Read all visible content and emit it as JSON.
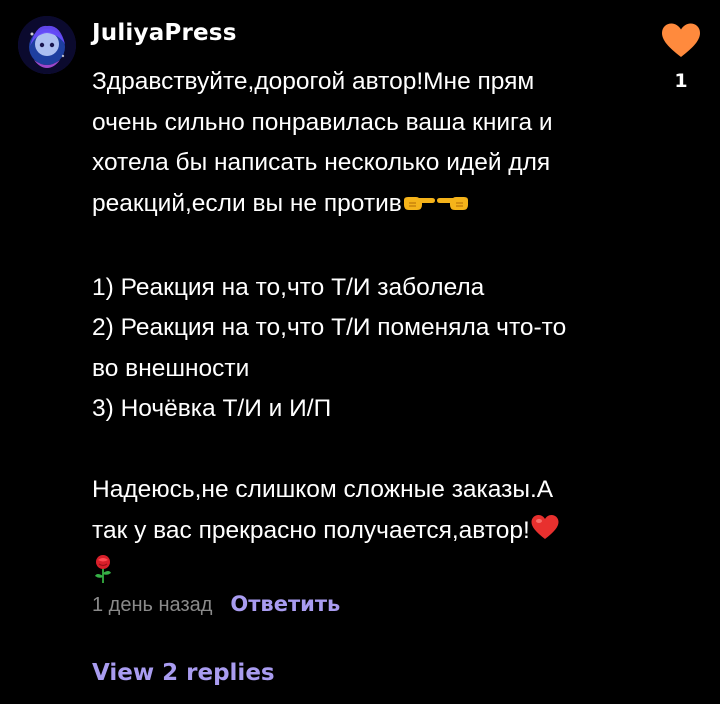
{
  "comment": {
    "username": "JuliyaPress",
    "like_count": "1",
    "paragraphs": {
      "intro": "Здравствуйте,дорогой автор!Мне прям\nочень сильно понравилась ваша книга и\nхотела бы написать несколько идей для\nреакций,если вы не против",
      "ideas": "1) Реакция на то,что Т/И заболела\n2) Реакция на то,что Т/И поменяла что-то\nво внешности\n3) Ночёвка Т/И и И/П",
      "outro": "Надеюсь,не слишком сложные заказы.А\nтак у вас прекрасно получается,автор!"
    },
    "emojis": [
      "pointing-right-hand",
      "pointing-left-hand",
      "red-heart",
      "rose"
    ],
    "timestamp": "1 день назад",
    "reply_label": "Ответить",
    "view_replies_label": "View 2 replies"
  },
  "colors": {
    "background": "#000000",
    "text": "#ffffff",
    "muted": "#8a8a8a",
    "accent": "#a99cf0",
    "like_heart": "#ff8a3d"
  }
}
